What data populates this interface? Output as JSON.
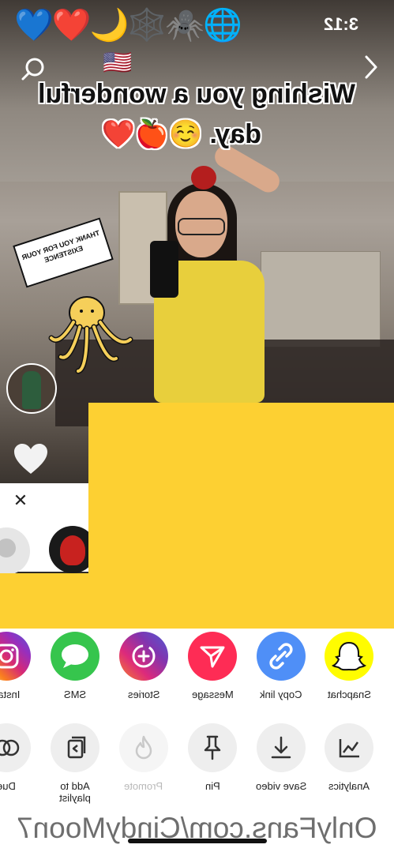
{
  "status_bar": {
    "time": "3:12",
    "emojis": "💙❤️🌙🕸️🕷️🌐"
  },
  "video": {
    "flag": "🇺🇸",
    "caption_line1": "Wishing you a wonderful",
    "caption_line2": "day. ☺️🍎❤️",
    "sticker_text": "THANK YOU FOR YOUR EXISTENCE"
  },
  "share_row1": [
    {
      "label": "Snapchat",
      "icon": "snapchat-ghost-icon"
    },
    {
      "label": "Copy link",
      "icon": "link-icon"
    },
    {
      "label": "Message",
      "icon": "send-icon"
    },
    {
      "label": "Stories",
      "icon": "stories-add-icon"
    },
    {
      "label": "SMS",
      "icon": "chat-bubble-icon"
    },
    {
      "label": "Instag",
      "icon": "instagram-icon"
    }
  ],
  "share_row2": [
    {
      "label": "Analytics",
      "icon": "analytics-chart-icon"
    },
    {
      "label": "Save video",
      "icon": "download-icon"
    },
    {
      "label": "Pin",
      "icon": "pin-icon"
    },
    {
      "label": "Promote",
      "icon": "flame-icon"
    },
    {
      "label": "Add to playlist",
      "icon": "playlist-add-icon"
    },
    {
      "label": "Due",
      "icon": "duet-icon"
    }
  ],
  "watermark": "OnlyFans.com/CindyMoon7",
  "colors": {
    "redaction": "#fdd032",
    "snapchat": "#fffc00",
    "copy_link": "#4f8ff7",
    "message": "#fe2c55",
    "sms": "#36c54d"
  }
}
